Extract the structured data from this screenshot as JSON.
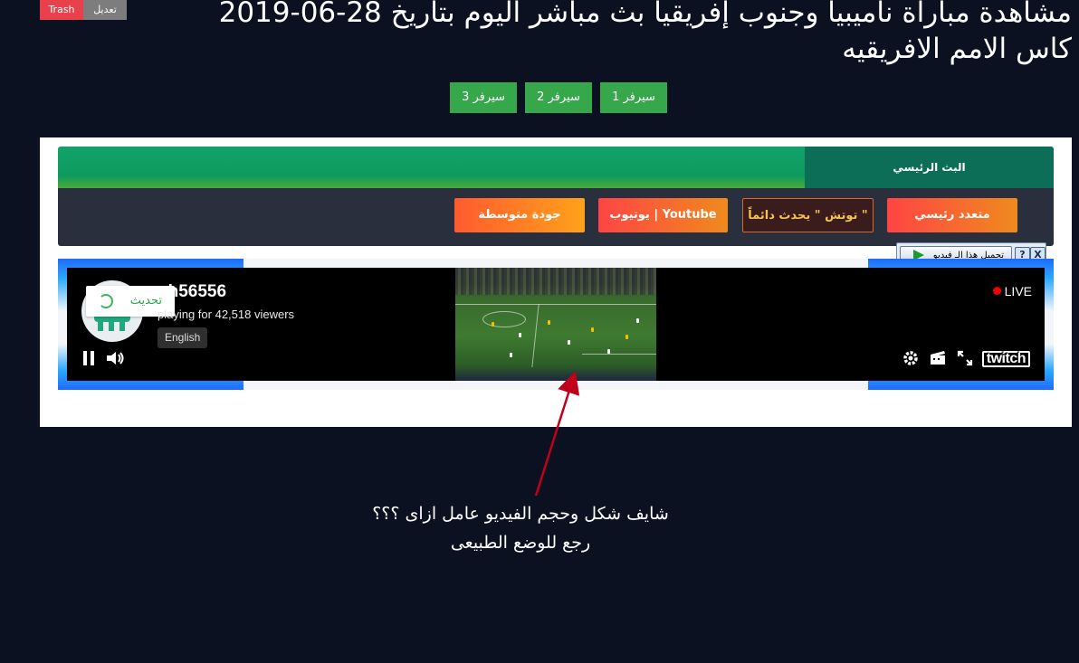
{
  "admin_bar": {
    "edit_label": "تعديل",
    "trash_label": "Trash"
  },
  "page": {
    "title": "مشاهدة مباراة ناميبيا وجنوب إفريقيا بث مباشر اليوم بتاريخ 28-06-2019 كاس الامم الافريقيه"
  },
  "servers": [
    {
      "label": "سيرفر 1"
    },
    {
      "label": "سيرفر 2"
    },
    {
      "label": "سيرفر 3"
    }
  ],
  "player_tabs": {
    "main_label": "البث الرئيسي"
  },
  "sources": {
    "multi_main": "متعدد رئيسي",
    "touch": "توتش \" يحدث دائماً \"",
    "youtube": "يوتيوب | Youtube",
    "medium_quality": "جودة متوسطة"
  },
  "download_bar": {
    "label": "تحميل هذا الـ فيديو",
    "help_icon": "?",
    "close_icon": "X"
  },
  "stream": {
    "refresh_label": "تحديث",
    "channel_name": "nh56556",
    "viewers_text": "playing for 42,518 viewers",
    "language": "English",
    "live_label": "LIVE",
    "brand": "twitch"
  },
  "annotation": {
    "line1": "شايف شكل وحجم الفيديو عامل ازاى ؟؟؟",
    "line2": "رجع للوضع الطبيعى"
  },
  "colors": {
    "page_bg": "#0b1120",
    "server_green": "#36a74a",
    "tab_green": "#11a36a",
    "tab_dark_green": "#0c6e57",
    "source_bar_bg": "#2a2f3d",
    "live_red": "#eb0400",
    "arrow_red": "#c0001a"
  }
}
